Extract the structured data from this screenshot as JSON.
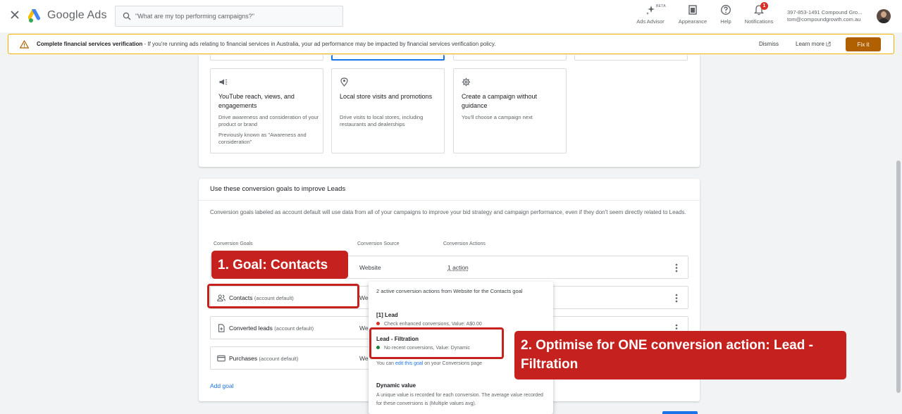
{
  "header": {
    "brand": "Google Ads",
    "search_placeholder": "\"What are my top performing campaigns?\"",
    "tools": {
      "ads_advisor": "Ads Advisor",
      "ads_advisor_badge": "BETA",
      "appearance": "Appearance",
      "help": "Help",
      "notifications": "Notifications",
      "notifications_count": "1"
    },
    "account": {
      "id": "397-853-1491 Compound Gro...",
      "email": "tom@compoundgrowth.com.au"
    }
  },
  "banner": {
    "title": "Complete financial services verification",
    "message": " - If you're running ads relating to financial services in Australia, your ad performance may be impacted by financial services verification policy.",
    "dismiss": "Dismiss",
    "learn_more": "Learn more",
    "fix_it": "Fix it",
    "accent_color": "#f4b400"
  },
  "objectives": [
    {
      "icon": "megaphone-icon",
      "title": "YouTube reach, views, and engagements",
      "description": "Drive awareness and consideration of your product or brand",
      "note": "Previously known as \"Awareness and consideration\""
    },
    {
      "icon": "location-pin-icon",
      "title": "Local store visits and promotions",
      "description": "Drive visits to local stores, including restaurants and dealerships"
    },
    {
      "icon": "gear-icon",
      "title": "Create a campaign without guidance",
      "description": "You'll choose a campaign next"
    }
  ],
  "conversion_section": {
    "title": "Use these conversion goals to improve Leads",
    "description": "Conversion goals labeled as account default will use data from all of your campaigns to improve your bid strategy and campaign performance, even if they don't seem directly related to Leads.",
    "columns": [
      "Conversion Goals",
      "Conversion Source",
      "Conversion Actions"
    ],
    "goals": [
      {
        "name": "",
        "source": "Website",
        "actions": "1 action"
      },
      {
        "name": "Contacts",
        "tag": "(account default)",
        "source": "We"
      },
      {
        "name": "Converted leads",
        "tag": "(account default)",
        "source": "We"
      },
      {
        "name": "Purchases",
        "tag": "(account default)",
        "source": "We"
      }
    ],
    "add_goal": "Add goal"
  },
  "popover": {
    "intro": "2 active conversion actions from Website for the Contacts goal",
    "actions": [
      {
        "name": "[1] Lead",
        "status": "Check enhanced conversions, Value: A$0.00",
        "status_color": "#d93025"
      },
      {
        "name": "Lead - Filtration",
        "status": "No recent conversions, Value: Dynamic",
        "status_color": "#188038"
      }
    ],
    "edit_prefix": "You can ",
    "edit_link": "edit this goal",
    "edit_suffix": " on your Conversions page",
    "dynamic_title": "Dynamic value",
    "dynamic_desc": "A unique value is recorded for each conversion. The average value recorded for these conversions is (Multiple values avg)."
  },
  "annotations": {
    "step1": "1. Goal: Contacts",
    "step2": "2. Optimise for ONE conversion action: Lead - Filtration",
    "color": "#c5221f"
  }
}
